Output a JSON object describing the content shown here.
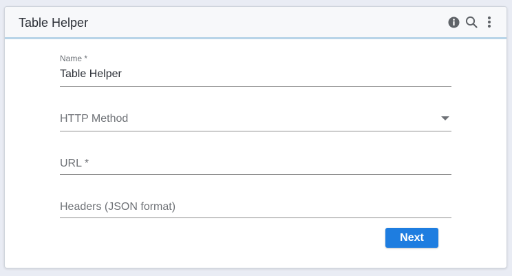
{
  "card": {
    "title": "Table Helper",
    "icons": [
      "info-icon",
      "search-icon",
      "more-vertical-icon"
    ]
  },
  "form": {
    "name": {
      "label": "Name *",
      "value": "Table Helper"
    },
    "http_method": {
      "placeholder": "HTTP Method",
      "value": ""
    },
    "url": {
      "placeholder": "URL *",
      "value": ""
    },
    "headers": {
      "placeholder": "Headers (JSON format)",
      "value": ""
    }
  },
  "actions": {
    "next_label": "Next"
  },
  "colors": {
    "accent": "#1e7de0",
    "header_border": "#b8d4e8",
    "background": "#e9ecf4"
  }
}
